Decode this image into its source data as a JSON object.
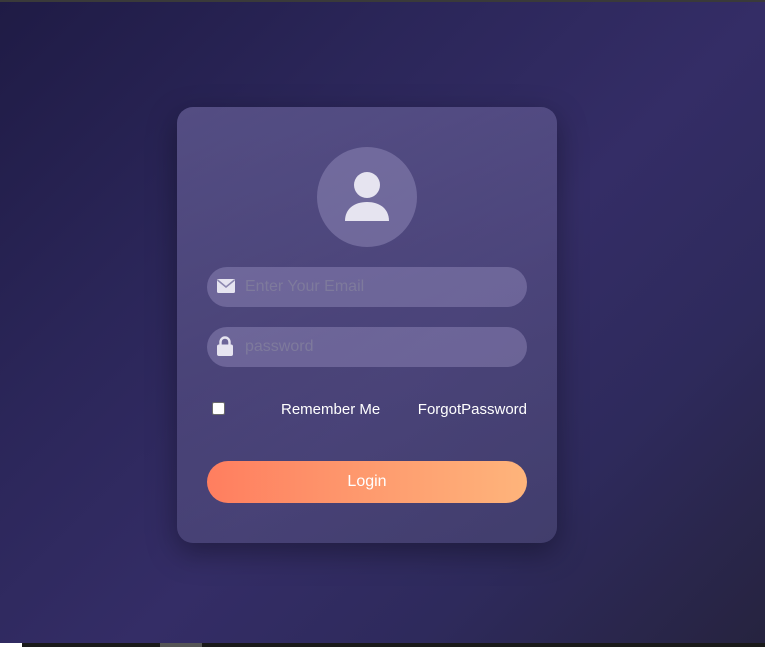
{
  "login_form": {
    "email_placeholder": "Enter Your Email",
    "email_value": "",
    "password_placeholder": "password",
    "password_value": "",
    "remember_me_label": "Remember Me",
    "remember_me_checked": false,
    "forgot_password_label": "ForgotPassword",
    "login_button_label": "Login"
  },
  "icons": {
    "avatar": "user-icon",
    "email": "envelope-icon",
    "password": "lock-icon"
  },
  "colors": {
    "background": "#2b2659",
    "button_start": "#ff7e5f",
    "button_end": "#feb47b"
  }
}
